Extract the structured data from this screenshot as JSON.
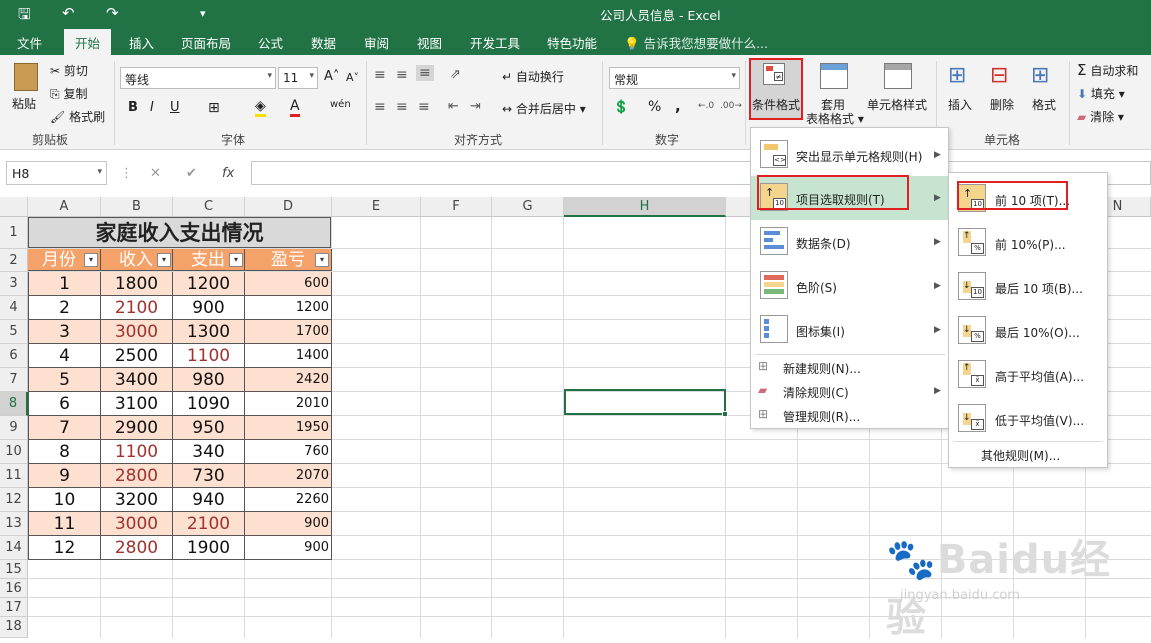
{
  "window": {
    "title": "公司人员信息 - Excel"
  },
  "quick_access": {
    "save_icon": "save-icon",
    "undo_icon": "undo-icon",
    "redo_icon": "redo-icon"
  },
  "tabs": [
    "文件",
    "开始",
    "插入",
    "页面布局",
    "公式",
    "数据",
    "审阅",
    "视图",
    "开发工具",
    "特色功能"
  ],
  "active_tab": "开始",
  "tell_me": "告诉我您想要做什么...",
  "ribbon": {
    "clipboard": {
      "paste": "粘贴",
      "cut": "剪切",
      "copy": "复制",
      "format_painter": "格式刷",
      "group": "剪贴板"
    },
    "font": {
      "name": "等线",
      "size": "11",
      "bold": "B",
      "italic": "I",
      "underline": "U",
      "wen": "wén",
      "group": "字体"
    },
    "align": {
      "wrap": "自动换行",
      "merge": "合并后居中",
      "group": "对齐方式"
    },
    "number": {
      "format": "常规",
      "percent": "%",
      "comma": ",",
      "group": "数字"
    },
    "styles": {
      "conditional": "条件格式",
      "table_a": "套用",
      "table_b": "表格格式",
      "cell_style": "单元格样式"
    },
    "cells": {
      "insert": "插入",
      "delete": "删除",
      "format": "格式",
      "group": "单元格"
    },
    "editing": {
      "autosum": "自动求和",
      "fill": "填充",
      "clear": "清除"
    }
  },
  "formula_bar": {
    "name_box": "H8",
    "fx": "fx"
  },
  "columns": [
    "A",
    "B",
    "C",
    "D",
    "E",
    "F",
    "G",
    "H",
    "N"
  ],
  "rows": [
    "1",
    "2",
    "3",
    "4",
    "5",
    "6",
    "7",
    "8",
    "9",
    "10",
    "11",
    "12",
    "13",
    "14",
    "15",
    "16",
    "17",
    "18"
  ],
  "sheet": {
    "title": "家庭收入支出情况",
    "headers": [
      "月份",
      "收入",
      "支出",
      "盈亏"
    ],
    "data": [
      {
        "month": "1",
        "income": "1800",
        "expense": "1200",
        "profit": "600"
      },
      {
        "month": "2",
        "income": "2100",
        "expense": "900",
        "profit": "1200"
      },
      {
        "month": "3",
        "income": "3000",
        "expense": "1300",
        "profit": "1700"
      },
      {
        "month": "4",
        "income": "2500",
        "expense": "1100",
        "profit": "1400"
      },
      {
        "month": "5",
        "income": "3400",
        "expense": "980",
        "profit": "2420"
      },
      {
        "month": "6",
        "income": "3100",
        "expense": "1090",
        "profit": "2010"
      },
      {
        "month": "7",
        "income": "2900",
        "expense": "950",
        "profit": "1950"
      },
      {
        "month": "8",
        "income": "1100",
        "expense": "340",
        "profit": "760"
      },
      {
        "month": "9",
        "income": "2800",
        "expense": "730",
        "profit": "2070"
      },
      {
        "month": "10",
        "income": "3200",
        "expense": "940",
        "profit": "2260"
      },
      {
        "month": "11",
        "income": "3000",
        "expense": "2100",
        "profit": "900"
      },
      {
        "month": "12",
        "income": "2800",
        "expense": "1900",
        "profit": "900"
      }
    ]
  },
  "cf_menu": [
    {
      "label": "突出显示单元格规则(H)"
    },
    {
      "label": "项目选取规则(T)"
    },
    {
      "label": "数据条(D)"
    },
    {
      "label": "色阶(S)"
    },
    {
      "label": "图标集(I)"
    },
    {
      "label": "新建规则(N)..."
    },
    {
      "label": "清除规则(C)"
    },
    {
      "label": "管理规则(R)..."
    }
  ],
  "submenu": [
    {
      "label": "前 10 项(T)...",
      "icon_text": "10"
    },
    {
      "label": "前 10%(P)...",
      "icon_text": "%"
    },
    {
      "label": "最后 10 项(B)...",
      "icon_text": "10"
    },
    {
      "label": "最后 10%(O)...",
      "icon_text": "%"
    },
    {
      "label": "高于平均值(A)...",
      "icon_text": "x̄"
    },
    {
      "label": "低于平均值(V)...",
      "icon_text": "x̄"
    },
    {
      "label": "其他规则(M)..."
    }
  ],
  "watermark": {
    "brand": "Baidu经验",
    "url": "jingyan.baidu.com"
  }
}
